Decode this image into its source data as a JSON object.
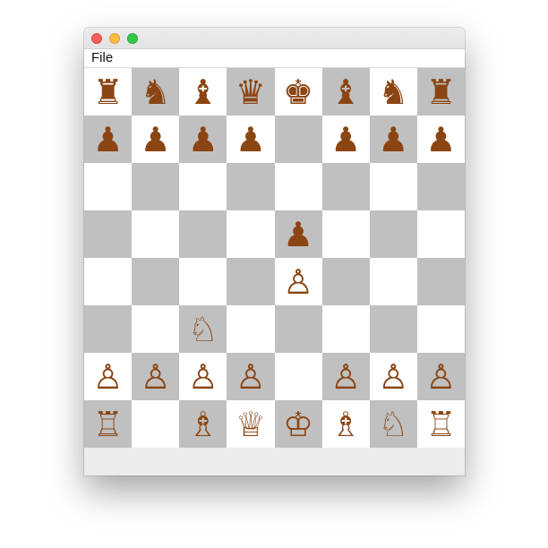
{
  "window": {
    "menu": [
      "File"
    ]
  },
  "colors": {
    "light_square": "#ffffff",
    "dark_square": "#c0c0c0",
    "piece": "#8b4513"
  },
  "board": {
    "rows": [
      [
        "bR",
        "bN",
        "bB",
        "bQ",
        "bK",
        "bB",
        "bN",
        "bR"
      ],
      [
        "bP",
        "bP",
        "bP",
        "bP",
        "",
        "bP",
        "bP",
        "bP"
      ],
      [
        "",
        "",
        "",
        "",
        "",
        "",
        "",
        ""
      ],
      [
        "",
        "",
        "",
        "",
        "bP",
        "",
        "",
        ""
      ],
      [
        "",
        "",
        "",
        "",
        "wP",
        "",
        "",
        ""
      ],
      [
        "",
        "",
        "wN",
        "",
        "",
        "",
        "",
        ""
      ],
      [
        "wP",
        "wP",
        "wP",
        "wP",
        "",
        "wP",
        "wP",
        "wP"
      ],
      [
        "wR",
        "",
        "wB",
        "wQ",
        "wK",
        "wB",
        "wN",
        "wR"
      ]
    ],
    "glyphs": {
      "bK": "♚",
      "bQ": "♛",
      "bR": "♜",
      "bB": "♝",
      "bN": "♞",
      "bP": "♟",
      "wK": "♔",
      "wQ": "♕",
      "wR": "♖",
      "wB": "♗",
      "wN": "♘",
      "wP": "♙"
    }
  }
}
